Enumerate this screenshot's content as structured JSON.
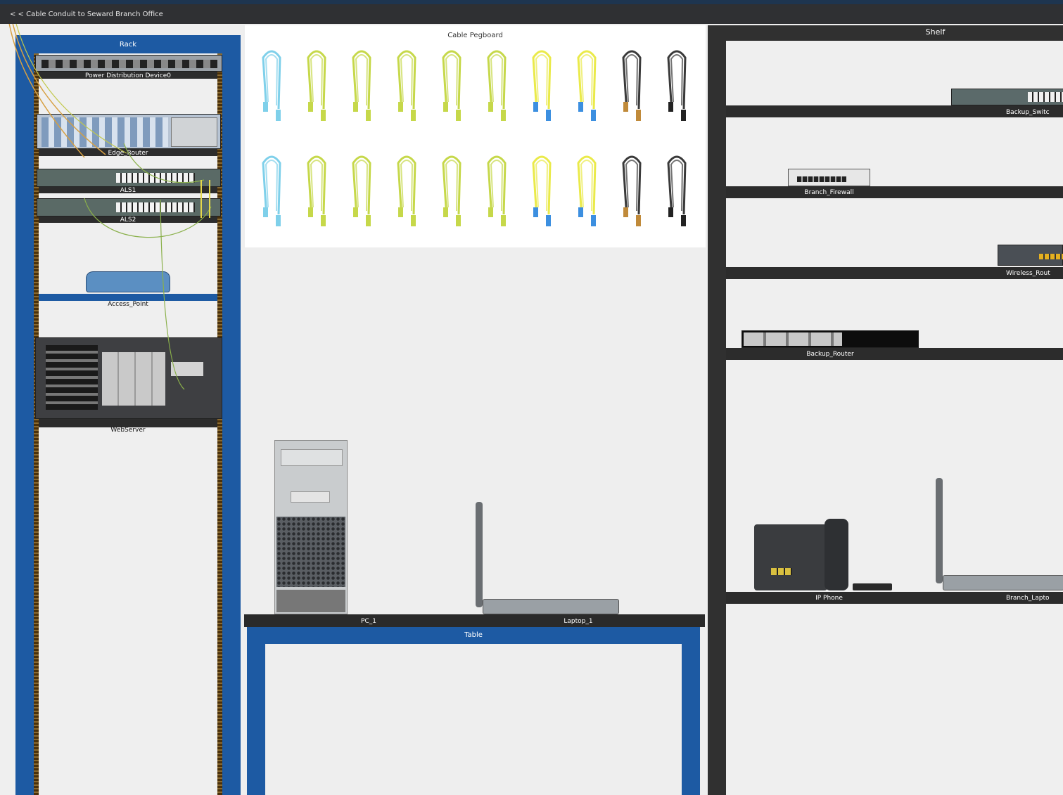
{
  "nav": {
    "back_link": "< < Cable Conduit to Seward Branch Office"
  },
  "rack": {
    "title": "Rack",
    "devices": [
      {
        "label": "Power Distribution Device0"
      },
      {
        "label": "Edge_Router"
      },
      {
        "label": "ALS1"
      },
      {
        "label": "ALS2"
      },
      {
        "label": "Access_Point"
      },
      {
        "label": "WebServer"
      }
    ]
  },
  "pegboard": {
    "title": "Cable Pegboard",
    "cables": [
      {
        "color": "#7fd0ea",
        "kind": "console-cable"
      },
      {
        "color": "#c6d84a",
        "kind": "straight-through-cable"
      },
      {
        "color": "#c6d84a",
        "kind": "straight-through-cable"
      },
      {
        "color": "#c6d84a",
        "kind": "straight-through-cable"
      },
      {
        "color": "#c6d84a",
        "kind": "crossover-cable"
      },
      {
        "color": "#c6d84a",
        "kind": "crossover-cable"
      },
      {
        "color": "#eaea4a",
        "kind": "fiber-cable"
      },
      {
        "color": "#eaea4a",
        "kind": "fiber-cable"
      },
      {
        "color": "#3a3a3a",
        "kind": "coaxial-cable"
      },
      {
        "color": "#3a3a3a",
        "kind": "usb-cable"
      }
    ]
  },
  "table": {
    "title": "Table",
    "devices": [
      {
        "label": "PC_1"
      },
      {
        "label": "Laptop_1"
      }
    ]
  },
  "shelf": {
    "title": "Shelf",
    "devices": [
      {
        "label": "Backup_Switc"
      },
      {
        "label": "Branch_Firewall"
      },
      {
        "label": "Wireless_Rout"
      },
      {
        "label": "Backup_Router"
      },
      {
        "label": "IP Phone"
      },
      {
        "label": "Branch_Lapto"
      }
    ]
  }
}
